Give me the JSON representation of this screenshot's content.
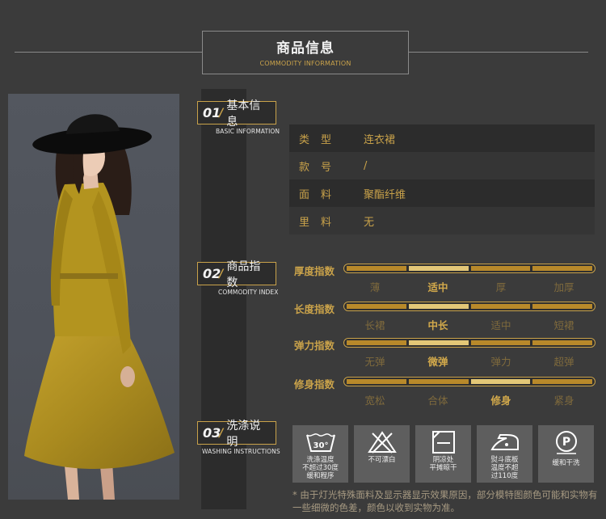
{
  "header": {
    "title": "商品信息",
    "subtitle": "COMMODITY INFORMATION"
  },
  "colors": {
    "background": "#3b3b3b",
    "panel": "#2c2c2c",
    "accent_gold": "#c9a24a",
    "selected_gold": "#e3c777",
    "icon_tile": "#5e5e5e"
  },
  "sections": {
    "basic": {
      "num": "01",
      "title": "基本信息",
      "subtitle": "BASIC INFORMATION"
    },
    "index": {
      "num": "02",
      "title": "商品指数",
      "subtitle": "COMMODITY INDEX"
    },
    "washing": {
      "num": "03",
      "title": "洗涤说明",
      "subtitle": "WASHING INSTRUCTIONS"
    }
  },
  "basic_info": [
    {
      "key": "类型",
      "value": "连衣裙"
    },
    {
      "key": "款号",
      "value": "/"
    },
    {
      "key": "面料",
      "value": "聚酯纤维"
    },
    {
      "key": "里料",
      "value": "无"
    }
  ],
  "indices": [
    {
      "label": "厚度指数",
      "options": [
        "薄",
        "适中",
        "厚",
        "加厚"
      ],
      "selected": "适中"
    },
    {
      "label": "长度指数",
      "options": [
        "长裙",
        "中长",
        "适中",
        "短裙"
      ],
      "selected": "中长"
    },
    {
      "label": "弹力指数",
      "options": [
        "无弹",
        "微弹",
        "弹力",
        "超弹"
      ],
      "selected": "微弹"
    },
    {
      "label": "修身指数",
      "options": [
        "宽松",
        "合体",
        "修身",
        "紧身"
      ],
      "selected": "修身"
    }
  ],
  "washing": [
    {
      "icon": "wash-30-icon",
      "text": "洗涤温度\n不超过30度\n缓和程序",
      "badge": "30°"
    },
    {
      "icon": "no-bleach-icon",
      "text": "不可漂白"
    },
    {
      "icon": "dry-flat-shade-icon",
      "text": "阴凉处\n平摊晾干"
    },
    {
      "icon": "iron-low-icon",
      "text": "熨斗底板\n温度不超\n过110度"
    },
    {
      "icon": "dry-clean-p-icon",
      "text": "缓和干洗",
      "badge": "P"
    }
  ],
  "footnote": "* 由于灯光特殊面料及显示器显示效果原因，部分模特图颜色可能和实物有一些细微的色差，颜色以收到实物为准。"
}
